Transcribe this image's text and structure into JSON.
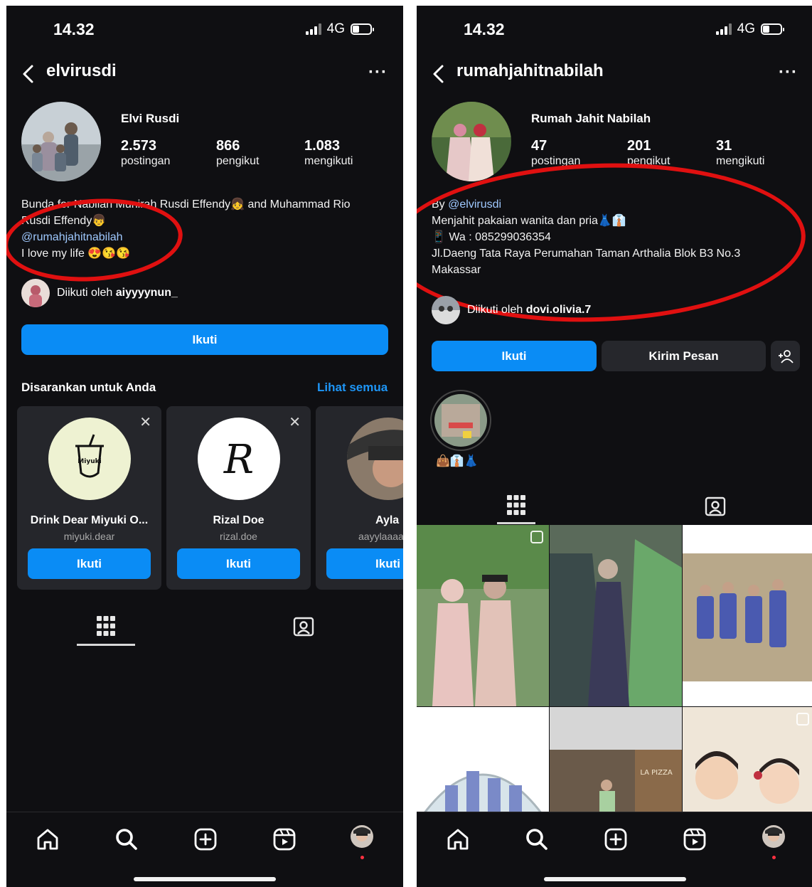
{
  "left": {
    "status": {
      "time": "14.32",
      "network": "4G"
    },
    "header": {
      "username": "elvirusdi"
    },
    "profile": {
      "display_name": "Elvi Rusdi",
      "stats": [
        {
          "value": "2.573",
          "label": "postingan"
        },
        {
          "value": "866",
          "label": "pengikut"
        },
        {
          "value": "1.083",
          "label": "mengikuti"
        }
      ],
      "bio_line1": "Bunda for Nabilah Munirah Rusdi Effendy👧 and Muhammad Rio",
      "bio_line2": "Rusdi Effendy👦",
      "bio_link": "@rumahjahitnabilah",
      "bio_line4": "I love my life 😍😘😘",
      "followed_prefix": "Diikuti oleh",
      "followed_user": "aiyyyynun_"
    },
    "follow_button": "Ikuti",
    "suggestions": {
      "title": "Disarankan untuk Anda",
      "see_all": "Lihat semua",
      "cards": [
        {
          "name": "Drink Dear Miyuki O...",
          "username": "miyuki.dear",
          "button": "Ikuti",
          "logo_text": "Miyuki"
        },
        {
          "name": "Rizal Doe",
          "username": "rizal.doe",
          "button": "Ikuti",
          "logo_text": "R"
        },
        {
          "name": "Ayla",
          "username": "aayylaaaa",
          "button": "Ikuti"
        }
      ]
    }
  },
  "right": {
    "status": {
      "time": "14.32",
      "network": "4G"
    },
    "header": {
      "username": "rumahjahitnabilah"
    },
    "profile": {
      "display_name": "Rumah Jahit Nabilah",
      "stats": [
        {
          "value": "47",
          "label": "postingan"
        },
        {
          "value": "201",
          "label": "pengikut"
        },
        {
          "value": "31",
          "label": "mengikuti"
        }
      ],
      "bio_by": "By",
      "bio_link": "@elvirusdi",
      "bio_line2": "Menjahit pakaian wanita dan pria👗👔",
      "bio_line3": "📱 Wa : 085299036354",
      "bio_line4": "Jl.Daeng Tata Raya Perumahan Taman Arthalia Blok B3 No.3",
      "bio_line5": "Makassar",
      "followed_prefix": "Diikuti oleh",
      "followed_user": "dovi.olivia.7"
    },
    "follow_button": "Ikuti",
    "message_button": "Kirim Pesan",
    "highlight_label": "👜👔👗",
    "post_sign": "LA PIZZA"
  },
  "colors": {
    "accent_blue": "#0a8cf5",
    "link_blue": "#9fc9ff",
    "annotation_red": "#e01010"
  }
}
